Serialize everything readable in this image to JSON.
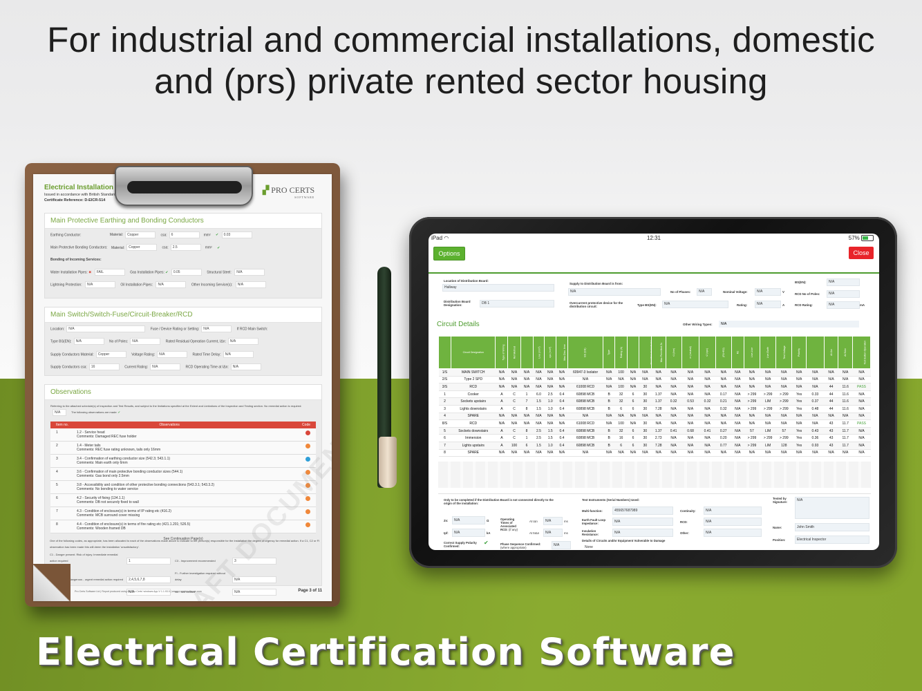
{
  "headline": {
    "line1": "For industrial and commercial installations, domestic",
    "line2": "and (prs) private rented sector housing"
  },
  "footer_title": "Electrical Certification Software",
  "clipboard_doc": {
    "title": "Electrical Installation Condition Report",
    "subtitle": "Issued in accordance with British Standard 7671 - Requirements for Electrical Installations",
    "cert_ref": "Certificate Reference: D-EICR-514",
    "logo_main": "PRO CERTS",
    "logo_sub": "SOFTWARE",
    "watermark": "DRAFT DOCUMENT",
    "section_earthing": "Main Protective Earthing and Bonding Conductors",
    "earthing_rows": [
      {
        "label": "Earthing Conductor:",
        "material_label": "Material:",
        "material": "Copper",
        "csa_label": "csa:",
        "csa": "6",
        "unit": "mm²",
        "continuity_label": "Connection / Continuity Verified:",
        "value": "0.03"
      },
      {
        "label": "Main Protective Bonding Conductors:",
        "material_label": "Material:",
        "material": "Copper",
        "csa_label": "csa:",
        "csa": "2.5",
        "unit": "mm²",
        "continuity_label": "Connection / Continuity Verified:",
        "value": ""
      }
    ],
    "bonding_label": "Bonding of Incoming Services:",
    "bonding_items": [
      {
        "label": "Water Installation Pipes:",
        "value": "FAIL"
      },
      {
        "label": "Gas Installation Pipes:",
        "value": "0.05"
      },
      {
        "label": "Structural Steel:",
        "value": "N/A"
      },
      {
        "label": "Lightning Protection:",
        "value": "N/A"
      },
      {
        "label": "Oil Installation Pipes:",
        "value": "N/A"
      },
      {
        "label": "Other Incoming Service(s):",
        "value": "N/A"
      }
    ],
    "section_switch": "Main Switch/Switch-Fuse/Circuit-Breaker/RCD",
    "switch_rows": [
      {
        "label": "Location:",
        "value": "N/A",
        "label2": "Fuse / Device Rating or Setting:",
        "value2": "N/A",
        "label3": "If RCD Main Switch:",
        "value3": ""
      },
      {
        "label": "Type BS(EN):",
        "value": "N/A",
        "label2": "No of Poles:",
        "value2": "N/A",
        "label3": "Rated Residual Operation Current, IΔn:",
        "value3": "N/A"
      },
      {
        "label": "Supply Conductors Material:",
        "value": "Copper",
        "label2": "Voltage Rating:",
        "value2": "N/A",
        "label3": "Rated Time Delay:",
        "value3": "N/A"
      },
      {
        "label": "Supply Conductors csa:",
        "value": "16",
        "label2": "Current Rating:",
        "value2": "N/A",
        "label3": "RCD Operating Time at IΔn:",
        "value3": "N/A"
      }
    ],
    "section_obs": "Observations",
    "obs_intro": "Referring to the attached schedule(s) of inspection and Test Results, and subject to the limitations specified at the Extent and Limitations of the Inspection and Testing section.",
    "obs_no_remedial": "No remedial action is required:",
    "obs_no_remedial_val": "N/A",
    "obs_following": "The following observations are made:",
    "obs_headers": {
      "item": "Item no.",
      "obs": "Observations",
      "code": "Code"
    },
    "observations": [
      {
        "no": "1",
        "text": "1.2 - Service head",
        "comment": "Comments: Damaged REC fuse holder",
        "color": "#d9473a"
      },
      {
        "no": "2",
        "text": "1.4 - Meter tails",
        "comment": "Comments: REC fuse rating unknown, tails only 16mm",
        "color": "#f0883a"
      },
      {
        "no": "3",
        "text": "3.4 - Confirmation of earthing conductor size (542.3; 543.1.1)",
        "comment": "Comments: Main earth only 6mm",
        "color": "#2f9fd8"
      },
      {
        "no": "4",
        "text": "3.6 - Confirmation of main protective bonding conductor sizes (544.1)",
        "comment": "Comments: Gas bond only 2.5mm",
        "color": "#f0883a"
      },
      {
        "no": "5",
        "text": "3.8 - Accessibility and condition of other protective bonding connections (543.3.1; 543.3.2)",
        "comment": "Comments: No bonding to water service",
        "color": "#f0883a"
      },
      {
        "no": "6",
        "text": "4.2 - Security of fixing (134.1.1)",
        "comment": "Comments: DB not securely fixed to wall",
        "color": "#f0883a"
      },
      {
        "no": "7",
        "text": "4.3 - Condition of enclosure(s) in terms of IP rating etc (416.2)",
        "comment": "Comments: MCB surround cover missing",
        "color": "#f0883a"
      },
      {
        "no": "8",
        "text": "4.4 - Condition of enclosure(s) in terms of fire rating etc (421.1.201; 526.5)",
        "comment": "Comments: Wooden framed DB",
        "color": "#f0883a"
      }
    ],
    "obs_continuation": "See Continuation Page(s)",
    "codes_intro": "One of the following codes, as appropriate, has been allocated to each of the observations made above to indicate to the person(s) responsible for the installation the degree of urgency for remedial action. If a C1, C2 or FI observation has been made this will deem the installation 'unsatisfactory'.",
    "codes": [
      {
        "label": "C1 - Danger present. Risk of injury. Immediate remedial action required",
        "value": "1",
        "label2": "C3 - Improvement recommended",
        "value2": "3"
      },
      {
        "label": "C2 - Potentially dangerous - urgent remedial action required",
        "value": "2,4,5,6,7,8",
        "label2": "FI - Further investigation required without delay",
        "value2": "N/A"
      },
      {
        "label": "",
        "value": "N/A",
        "label2": "N/I - Not Verified",
        "value2": "N/A"
      }
    ],
    "footer_note": "Pro Certs Software Ltd | Report produced using the Pro Certs' windows App V 1.1.93.0 | www.procertssoftware.com",
    "page": "Page 3 of 11"
  },
  "tablet": {
    "status": {
      "device": "iPad",
      "time": "12:31",
      "battery": "57%"
    },
    "options_label": "Options",
    "close_label": "Close",
    "db": {
      "location_label": "Location of Distribution Board:",
      "location": "Hallway",
      "designation_label": "Distribution Board Designation:",
      "designation": "DB 1",
      "supply_from_label": "Supply to Distribution Board is from:",
      "supply_from": "N/A",
      "phases_label": "No of Phases:",
      "phases": "N/A",
      "nominal_voltage_label": "Nominal Voltage:",
      "nominal_voltage": "N/A",
      "voltage_unit": "V",
      "ocpd_label": "Overcurrent protective device for the distribution circuit:",
      "type_bs_label": "Type BS(EN):",
      "type_bs": "N/A",
      "rating_label": "Rating:",
      "rating": "N/A",
      "rating_unit": "A",
      "bs_en_label": "BS(EN):",
      "bs_en": "N/A",
      "rcd_poles_label": "RCD No of Poles:",
      "rcd_poles": "N/A",
      "rcd_rating_label": "RCD Rating:",
      "rcd_rating": "N/A",
      "rcd_rating_unit": "mA"
    },
    "circuit_title": "Circuit Details",
    "other_wiring_label": "Other Wiring Types:",
    "other_wiring": "N/A",
    "table_headers": [
      "Circuit Number and Line",
      "Circuit Designation",
      "Type of Wiring",
      "Ref Method",
      "Number of Points Served",
      "Live (mm²)",
      "cpc (mm²)",
      "Max Disc. time",
      "BS (EN)",
      "Type",
      "Rating (A)",
      "Short Circuit Capacity (kA)",
      "Operating Current IΔn",
      "Max Permitted Zs",
      "r1 (line)",
      "rn (neutral)",
      "r2 (cpc)",
      "(R1+R2)",
      "R2",
      "Live-Live",
      "Live-Earth",
      "Test Voltage",
      "Polarity",
      "Max Measured Earth Fault Loop Impedance Zs",
      "At IΔn",
      "At 5IΔn",
      "Test Button Operation"
    ],
    "table_groups": {
      "conductors": "Circuit Conductors: csa",
      "ocpd": "Overcurrent Protective Devices",
      "rcd": "RCD",
      "impedance": "Circuit Impedance (ohms)",
      "ring": "Ring Final Circuits only",
      "all": "All circuits",
      "insulation": "Insulation Resistance",
      "rcd_times": "RCD Operating Times"
    },
    "rows": [
      [
        "1/S",
        "MAIN SWITCH",
        "N/A",
        "N/A",
        "N/A",
        "N/A",
        "N/A",
        "N/A",
        "60947-3 Isolator",
        "N/A",
        "100",
        "N/A",
        "N/A",
        "N/A",
        "N/A",
        "N/A",
        "N/A",
        "N/A",
        "N/A",
        "N/A",
        "N/A",
        "N/A",
        "N/A",
        "N/A",
        "N/A",
        "N/A",
        "N/A"
      ],
      [
        "2/S",
        "Type 2 SPD",
        "N/A",
        "N/A",
        "N/A",
        "N/A",
        "N/A",
        "N/A",
        "N/A",
        "N/A",
        "N/A",
        "N/A",
        "N/A",
        "N/A",
        "N/A",
        "N/A",
        "N/A",
        "N/A",
        "N/A",
        "N/A",
        "N/A",
        "N/A",
        "N/A",
        "N/A",
        "N/A",
        "N/A",
        "N/A"
      ],
      [
        "3/S",
        "RCD",
        "N/A",
        "N/A",
        "N/A",
        "N/A",
        "N/A",
        "N/A",
        "61008 RCD",
        "N/A",
        "100",
        "N/A",
        "30",
        "N/A",
        "N/A",
        "N/A",
        "N/A",
        "N/A",
        "N/A",
        "N/A",
        "N/A",
        "N/A",
        "N/A",
        "N/A",
        "44",
        "11.6",
        "PASS"
      ],
      [
        "1",
        "Cooker",
        "A",
        "C",
        "1",
        "6.0",
        "2.5",
        "0.4",
        "60898 MCB",
        "B",
        "32",
        "6",
        "30",
        "1.37",
        "N/A",
        "N/A",
        "N/A",
        "0.17",
        "N/A",
        "> 299",
        "> 299",
        "> 299",
        "Yes",
        "0.33",
        "44",
        "11.6",
        "N/A"
      ],
      [
        "2",
        "Sockets upstairs",
        "A",
        "C",
        "7",
        "1.5",
        "1.0",
        "0.4",
        "60898 MCB",
        "B",
        "32",
        "6",
        "30",
        "1.37",
        "0.32",
        "0.53",
        "0.32",
        "0.21",
        "N/A",
        "> 299",
        "LIM",
        "> 299",
        "Yes",
        "0.37",
        "44",
        "11.6",
        "N/A"
      ],
      [
        "3",
        "Lights downstairs",
        "A",
        "C",
        "8",
        "1.5",
        "1.0",
        "0.4",
        "60898 MCB",
        "B",
        "6",
        "6",
        "30",
        "7.28",
        "N/A",
        "N/A",
        "N/A",
        "0.32",
        "N/A",
        "> 299",
        "> 299",
        "> 299",
        "Yes",
        "0.48",
        "44",
        "11.6",
        "N/A"
      ],
      [
        "4",
        "SPARE",
        "N/A",
        "N/A",
        "N/A",
        "N/A",
        "N/A",
        "N/A",
        "N/A",
        "N/A",
        "N/A",
        "N/A",
        "N/A",
        "N/A",
        "N/A",
        "N/A",
        "N/A",
        "N/A",
        "N/A",
        "N/A",
        "N/A",
        "N/A",
        "N/A",
        "N/A",
        "N/A",
        "N/A",
        "N/A"
      ],
      [
        "8/S",
        "RCD",
        "N/A",
        "N/A",
        "N/A",
        "N/A",
        "N/A",
        "N/A",
        "61008 RCD",
        "N/A",
        "100",
        "N/A",
        "30",
        "N/A",
        "N/A",
        "N/A",
        "N/A",
        "N/A",
        "N/A",
        "N/A",
        "N/A",
        "N/A",
        "N/A",
        "N/A",
        "43",
        "11.7",
        "PASS"
      ],
      [
        "5",
        "Sockets downstairs",
        "A",
        "C",
        "8",
        "2.5",
        "1.5",
        "0.4",
        "60898 MCB",
        "B",
        "32",
        "6",
        "30",
        "1.37",
        "0.41",
        "0.68",
        "0.41",
        "0.27",
        "N/A",
        "57",
        "LIM",
        "57",
        "Yes",
        "0.43",
        "43",
        "11.7",
        "N/A"
      ],
      [
        "6",
        "Immersion",
        "A",
        "C",
        "1",
        "2.5",
        "1.5",
        "0.4",
        "60898 MCB",
        "B",
        "16",
        "6",
        "30",
        "2.73",
        "N/A",
        "N/A",
        "N/A",
        "0.20",
        "N/A",
        "> 299",
        "> 299",
        "> 299",
        "Yes",
        "0.36",
        "43",
        "11.7",
        "N/A"
      ],
      [
        "7",
        "Lights upstairs",
        "A",
        "100",
        "6",
        "1.5",
        "1.0",
        "0.4",
        "60898 MCB",
        "B",
        "6",
        "6",
        "30",
        "7.28",
        "N/A",
        "N/A",
        "N/A",
        "0.77",
        "N/A",
        "> 299",
        "LIM",
        "128",
        "Yes",
        "0.93",
        "43",
        "11.7",
        "N/A"
      ],
      [
        "8",
        "SPARE",
        "N/A",
        "N/A",
        "N/A",
        "N/A",
        "N/A",
        "N/A",
        "N/A",
        "N/A",
        "N/A",
        "N/A",
        "N/A",
        "N/A",
        "N/A",
        "N/A",
        "N/A",
        "N/A",
        "N/A",
        "N/A",
        "N/A",
        "N/A",
        "N/A",
        "N/A",
        "N/A",
        "N/A",
        "N/A"
      ]
    ],
    "bottom": {
      "origin_note": "Only to be completed if the Distribution Board is not connected directly to the origin of the installation:",
      "zs_label": "Zs:",
      "zs": "N/A",
      "zs_unit": "Ω",
      "ipf_label": "Ipf:",
      "ipf": "N/A",
      "ipf_unit": "kA",
      "op_times_label": "Operating Times of Associated RCD:",
      "op_times_sub": "(if any)",
      "at_idn_label": "At IΔn",
      "at_idn": "N/A",
      "at_5idn_label": "At 5IΔn",
      "at_5idn": "N/A",
      "ms": "ms",
      "polarity_label": "Correct Supply Polarity Confirmed:",
      "phase_seq_label": "Phase Sequence Confirmed:",
      "phase_seq_sub": "(where appropriate)",
      "phase_seq": "N/A",
      "instruments_label": "Test Instruments (Serial Numbers) Used:",
      "multi_label": "Multi-function:",
      "multi": "455657687989",
      "continuity_label": "Continuity:",
      "continuity": "N/A",
      "efli_label": "Earth Fault Loop Impedance:",
      "efli": "N/A",
      "rcd_label": "RCD:",
      "rcd": "N/A",
      "insulation_label": "Insulation Resistance:",
      "insulation": "N/A",
      "other_label": "Other:",
      "other": "N/A",
      "vulnerable_label": "Details of Circuits and/or Equipment Vulnerable to Damage",
      "vulnerable": "None",
      "tested_by_label": "Tested by Signature:",
      "tested_by": "N/A",
      "name_label": "Name:",
      "name": "John Smith",
      "position_label": "Position:",
      "position": "Electrical Inspector"
    }
  }
}
